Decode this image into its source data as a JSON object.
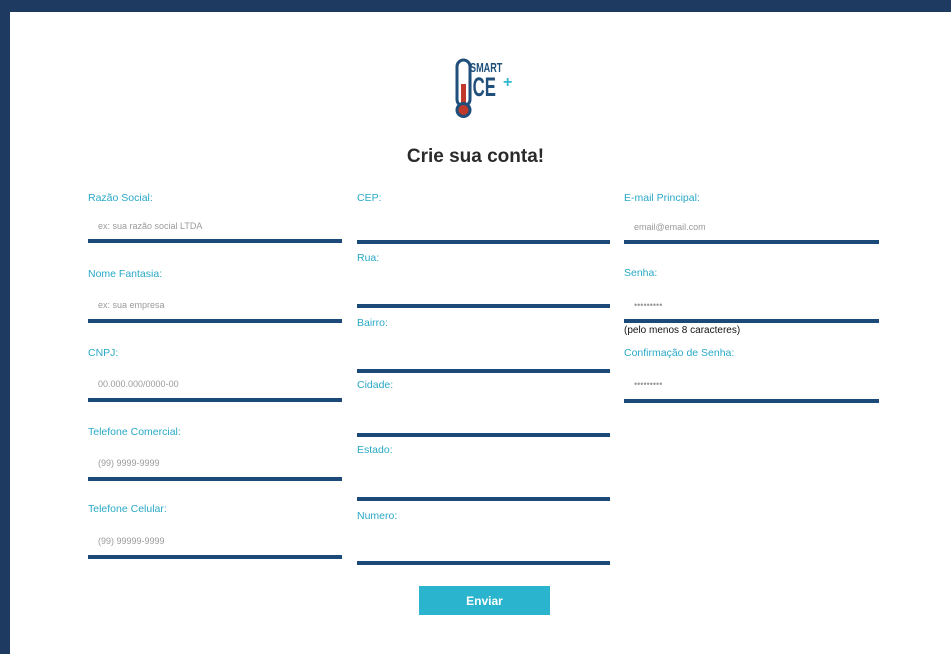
{
  "brand": {
    "line1": "SMART",
    "line2": "ICE",
    "plus": "+"
  },
  "title": "Crie sua conta!",
  "columns": {
    "left": [
      {
        "label": "Razão Social:",
        "placeholder": "ex: sua razão social LTDA"
      },
      {
        "label": "Nome Fantasia:",
        "placeholder": "ex: sua empresa"
      },
      {
        "label": "CNPJ:",
        "placeholder": "00.000.000/0000-00"
      },
      {
        "label": "Telefone Comercial:",
        "placeholder": "(99) 9999-9999"
      },
      {
        "label": "Telefone Celular:",
        "placeholder": "(99) 99999-9999"
      }
    ],
    "middle": [
      {
        "label": "CEP:",
        "placeholder": ""
      },
      {
        "label": "Rua:",
        "placeholder": ""
      },
      {
        "label": "Bairro:",
        "placeholder": ""
      },
      {
        "label": "Cidade:",
        "placeholder": ""
      },
      {
        "label": "Estado:",
        "placeholder": ""
      },
      {
        "label": "Numero:",
        "placeholder": ""
      }
    ],
    "right": [
      {
        "label": "E-mail Principal:",
        "placeholder": "email@email.com"
      },
      {
        "label": "Senha:",
        "placeholder": "•••••••••"
      },
      {
        "label": "Confirmação de Senha:",
        "placeholder": "•••••••••"
      }
    ]
  },
  "password_note": "(pelo menos 8 caracteres)",
  "submit_label": "Enviar",
  "colors": {
    "frame": "#1f3a60",
    "accent": "#2ab4cd",
    "underline": "#1c4a78",
    "label": "#29a9c6"
  }
}
